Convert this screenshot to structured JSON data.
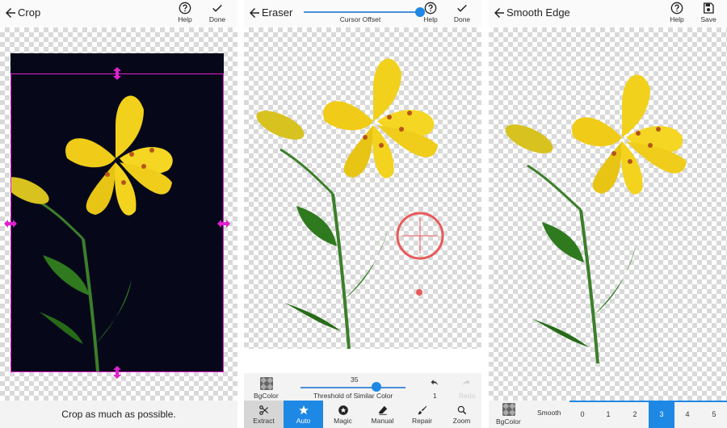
{
  "crop_screen": {
    "title": "Crop",
    "help_label": "Help",
    "done_label": "Done",
    "message": "Crop as much as possible."
  },
  "eraser_screen": {
    "title": "Eraser",
    "cursor_offset_label": "Cursor Offset",
    "cursor_offset_level": 1.0,
    "help_label": "Help",
    "done_label": "Done",
    "bgcolor_label": "BgColor",
    "threshold_value": "35",
    "threshold_label": "Threshold of Similar Color",
    "threshold_level": 0.7,
    "undo_count": "1",
    "redo_label": "Redo",
    "tools": [
      "Extract",
      "Auto",
      "Magic",
      "Manual",
      "Repair",
      "Zoom"
    ],
    "active_tool": "Auto"
  },
  "smooth_screen": {
    "title": "Smooth Edge",
    "help_label": "Help",
    "save_label": "Save",
    "bgcolor_label": "BgColor",
    "smooth_label": "Smooth",
    "levels": [
      "0",
      "1",
      "2",
      "3",
      "4",
      "5"
    ],
    "selected_level": "3"
  },
  "colors": {
    "accent": "#1e88e5",
    "crop_frame": "#e020d0",
    "petal": "#f2d11c",
    "leaf": "#2f7a1f",
    "cursor_ring": "#e85a5a"
  }
}
